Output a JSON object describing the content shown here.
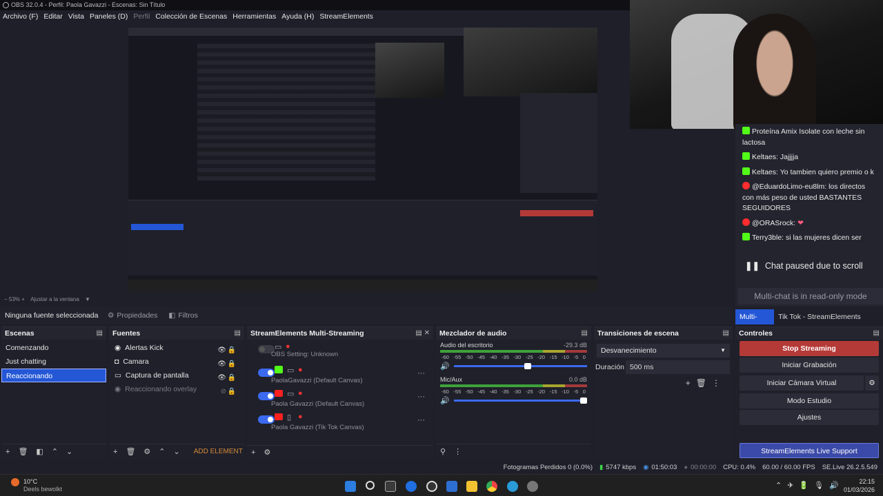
{
  "window": {
    "title": "OBS 32.0.4 - Perfil: Paola Gavazzi - Escenas: Sin Título"
  },
  "menu": [
    "Archivo (F)",
    "Editar",
    "Vista",
    "Paneles (D)",
    "Perfil",
    "Colección de Escenas",
    "Herramientas",
    "Ayuda (H)",
    "StreamElements"
  ],
  "chat": {
    "messages": [
      {
        "user": "",
        "text": "Proteína Amix Isolate con leche sin lactosa",
        "platform": "kick"
      },
      {
        "user": "Keltaes:",
        "text": "Jajjjja",
        "platform": "kick"
      },
      {
        "user": "Keltaes:",
        "text": "Yo tambien quiero premio o k",
        "platform": "kick"
      },
      {
        "user": "@EduardoLimo-eu8lm:",
        "text": "los directos con más peso de usted BASTANTES SEGUIDORES",
        "platform": "youtube"
      },
      {
        "user": "@ORASrock:",
        "text": "",
        "platform": "youtube"
      },
      {
        "user": "Terry3ble:",
        "text": "si las mujeres dicen ser",
        "platform": "kick"
      }
    ],
    "paused": "Chat paused due to scroll",
    "readonly": "Multi-chat is in read-only mode",
    "tabs": [
      "Multi-Chat",
      "Tik Tok - StreamElements Canvas"
    ]
  },
  "zoom": {
    "level": "53%",
    "fit": "Ajustar a la ventana"
  },
  "source_bar": {
    "none": "Ninguna fuente seleccionada",
    "properties": "Propiedades",
    "filters": "Filtros"
  },
  "scenes": {
    "title": "Escenas",
    "items": [
      "Comenzando",
      "Just chatting",
      "Reaccionando"
    ],
    "selected": 2
  },
  "sources": {
    "title": "Fuentes",
    "items": [
      {
        "name": "Alertas Kick",
        "visible": true
      },
      {
        "name": "Camara",
        "visible": true
      },
      {
        "name": "Captura de pantalla",
        "visible": true
      },
      {
        "name": "Reaccionando overlay",
        "visible": false
      }
    ],
    "add_element": "ADD ELEMENT"
  },
  "multistream": {
    "title": "StreamElements Multi-Streaming",
    "rows": [
      {
        "label": "OBS Setting: Unknown",
        "enabled": false
      },
      {
        "label": "PaolaGavazzi (Default Canvas)",
        "enabled": true
      },
      {
        "label": "Paola Gavazzi (Default Canvas)",
        "enabled": true
      },
      {
        "label": "Paola Gavazzi (Tik Tok Canvas)",
        "enabled": true
      }
    ]
  },
  "mixer": {
    "title": "Mezclador de audio",
    "channels": [
      {
        "name": "Audio del escritorio",
        "db": "-29.3 dB",
        "level": 0.58
      },
      {
        "name": "Mic/Aux",
        "db": "0.0 dB",
        "level": 1.0
      }
    ],
    "ticks": [
      "-60",
      "-55",
      "-50",
      "-45",
      "-40",
      "-35",
      "-30",
      "-25",
      "-20",
      "-15",
      "-10",
      "-5",
      "0"
    ]
  },
  "transitions": {
    "title": "Transiciones de escena",
    "selected": "Desvanecimiento",
    "duration_label": "Duración",
    "duration": "500 ms"
  },
  "controls": {
    "title": "Controles",
    "stop": "Stop Streaming",
    "record": "Iniciar Grabación",
    "virtualcam": "Iniciar Cámara Virtual",
    "studio": "Modo Estudio",
    "settings": "Ajustes",
    "support": "StreamElements Live Support"
  },
  "status": {
    "dropped": "Fotogramas Perdidos 0 (0.0%)",
    "kbps": "5747 kbps",
    "live": "01:50:03",
    "rec": "00:00:00",
    "cpu": "CPU: 0.4%",
    "fps": "60.00 / 60.00 FPS",
    "version": "SE.Live 26.2.5.549"
  },
  "taskbar": {
    "temp": "10°C",
    "weather": "Deels bewolkt",
    "time": "22:15",
    "date": "01/03/2026"
  }
}
